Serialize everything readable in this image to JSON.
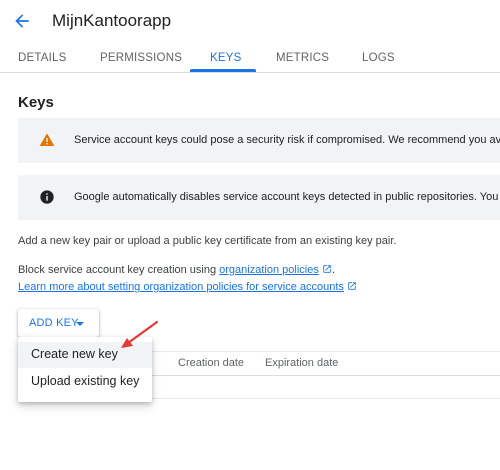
{
  "header": {
    "back_icon": "arrow-back-icon",
    "title": "MijnKantoorapp"
  },
  "tabs": [
    {
      "label": "DETAILS",
      "active": false
    },
    {
      "label": "PERMISSIONS",
      "active": false
    },
    {
      "label": "KEYS",
      "active": true
    },
    {
      "label": "METRICS",
      "active": false
    },
    {
      "label": "LOGS",
      "active": false
    }
  ],
  "main": {
    "title": "Keys",
    "warning": {
      "icon": "warning-icon",
      "text": "Service account keys could pose a security risk if compromised. We recommend you avoi"
    },
    "info": {
      "icon": "info-icon",
      "text": "Google automatically disables service account keys detected in public repositories. You c"
    },
    "description": "Add a new key pair or upload a public key certificate from an existing key pair.",
    "policy_text": "Block service account key creation using ",
    "policy_link": "organization policies",
    "policy_suffix": ".",
    "learn_more_link": "Learn more about setting organization policies for service accounts"
  },
  "add_key": {
    "label": "ADD KEY",
    "icon": "arrow-drop-down-icon"
  },
  "menu": {
    "items": [
      {
        "label": "Create new key",
        "highlighted": true
      },
      {
        "label": "Upload existing key",
        "highlighted": false
      }
    ]
  },
  "table": {
    "columns": [
      "Creation date",
      "Expiration date"
    ]
  },
  "colors": {
    "accent": "#1a73e8",
    "warning": "#e37400",
    "annotation_arrow": "#e53935"
  }
}
